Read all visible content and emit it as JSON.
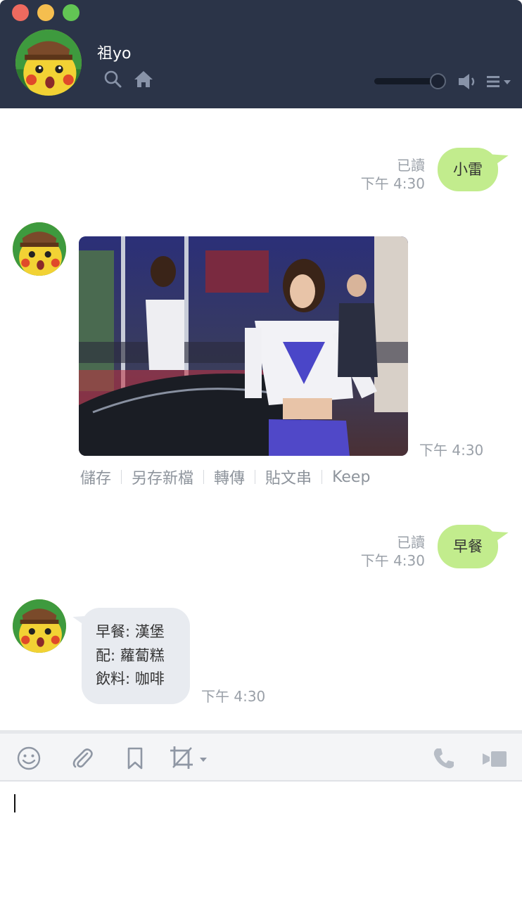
{
  "window": {
    "title_bar_buttons": [
      "close",
      "minimize",
      "zoom"
    ]
  },
  "header": {
    "contact_name": "祖yo",
    "icons": [
      "search-icon",
      "home-icon",
      "speaker-icon",
      "menu-icon"
    ],
    "volume_level": 0.9
  },
  "messages": [
    {
      "type": "sent",
      "text": "小雷",
      "read_label": "已讀",
      "time": "下午 4:30"
    },
    {
      "type": "received-image",
      "time": "下午 4:30",
      "actions": [
        "儲存",
        "另存新檔",
        "轉傳",
        "貼文串",
        "Keep"
      ]
    },
    {
      "type": "sent",
      "text": "早餐",
      "read_label": "已讀",
      "time": "下午 4:30"
    },
    {
      "type": "received",
      "lines": [
        "早餐: 漢堡",
        "配: 蘿蔔糕",
        "飲料: 咖啡"
      ],
      "time": "下午 4:30"
    }
  ],
  "toolbar": {
    "icons": [
      "emoji-icon",
      "attach-icon",
      "bookmark-icon",
      "crop-icon",
      "phone-icon",
      "video-icon"
    ]
  },
  "input": {
    "value": ""
  },
  "colors": {
    "header_bg": "#2b3448",
    "sent_bubble": "#c2ec8d",
    "received_bubble": "#e8ebf0",
    "meta_text": "#9aa0a8"
  }
}
